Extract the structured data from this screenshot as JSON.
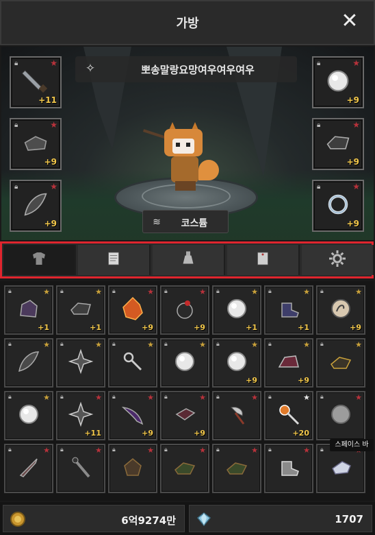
{
  "window": {
    "title": "가방",
    "close_icon": "close-icon"
  },
  "character": {
    "name": "뽀송말랑요망여우여우여우"
  },
  "costume_button": {
    "label": "코스튬",
    "icon": "layers-icon"
  },
  "equipped_left": [
    {
      "icon": "sword-icon",
      "enhance": "+11",
      "star": "red"
    },
    {
      "icon": "armor-icon",
      "enhance": "+9",
      "star": "red"
    },
    {
      "icon": "feather-icon",
      "enhance": "+9",
      "star": "red"
    }
  ],
  "equipped_right": [
    {
      "icon": "orb-icon",
      "enhance": "+9",
      "star": "red"
    },
    {
      "icon": "stone-icon",
      "enhance": "+9",
      "star": "red"
    },
    {
      "icon": "ring-icon",
      "enhance": "+9",
      "star": "red"
    }
  ],
  "tabs": [
    {
      "icon": "shirt-icon",
      "active": true
    },
    {
      "icon": "scroll-icon",
      "active": false
    },
    {
      "icon": "potion-icon",
      "active": false
    },
    {
      "icon": "note-icon",
      "active": false
    },
    {
      "icon": "gear-icon",
      "active": false
    }
  ],
  "inventory": [
    {
      "icon": "helmet-icon",
      "enhance": "+1",
      "star": "gold"
    },
    {
      "icon": "stone-icon",
      "enhance": "+1",
      "star": "gold"
    },
    {
      "icon": "fire-crystal-icon",
      "enhance": "+9",
      "star": "red"
    },
    {
      "icon": "bomb-icon",
      "enhance": "+9",
      "star": "red"
    },
    {
      "icon": "orb-icon",
      "enhance": "+1",
      "star": "gold"
    },
    {
      "icon": "boot-icon",
      "enhance": "+1",
      "star": "gold"
    },
    {
      "icon": "coin-orb-icon",
      "enhance": "+9",
      "star": "gold"
    },
    {
      "icon": "feather-icon",
      "enhance": "",
      "star": "gold"
    },
    {
      "icon": "shuriken-icon",
      "enhance": "",
      "star": "gold"
    },
    {
      "icon": "key-icon",
      "enhance": "",
      "star": "gold"
    },
    {
      "icon": "orb-icon",
      "enhance": "",
      "star": "gold"
    },
    {
      "icon": "orb-icon",
      "enhance": "+9",
      "star": "gold"
    },
    {
      "icon": "hat-icon",
      "enhance": "+9",
      "star": "gold"
    },
    {
      "icon": "bundle-icon",
      "enhance": "",
      "star": "gold"
    },
    {
      "icon": "orb-icon",
      "enhance": "",
      "star": "gold"
    },
    {
      "icon": "shuriken-icon",
      "enhance": "+11",
      "star": "red"
    },
    {
      "icon": "cape-icon",
      "enhance": "+9",
      "star": "red"
    },
    {
      "icon": "book-icon",
      "enhance": "+9",
      "star": "red"
    },
    {
      "icon": "axe-icon",
      "enhance": "",
      "star": "red"
    },
    {
      "icon": "wand-icon",
      "enhance": "+20",
      "star": "white"
    },
    {
      "icon": "orb-gray-icon",
      "enhance": "",
      "star": "red"
    },
    {
      "icon": "dagger-icon",
      "enhance": "",
      "star": "red"
    },
    {
      "icon": "staff-icon",
      "enhance": "",
      "star": "red"
    },
    {
      "icon": "vest-icon",
      "enhance": "",
      "star": "red"
    },
    {
      "icon": "cloth-icon",
      "enhance": "",
      "star": "red"
    },
    {
      "icon": "cloth-icon",
      "enhance": "",
      "star": "red"
    },
    {
      "icon": "boot-gray-icon",
      "enhance": "",
      "star": "red"
    },
    {
      "icon": "glove-icon",
      "enhance": "",
      "star": "red"
    }
  ],
  "tooltip": {
    "text": "스페이스 바"
  },
  "currency": {
    "gold": {
      "icon": "gold-coin-icon",
      "value": "6억9274만"
    },
    "gem": {
      "icon": "diamond-icon",
      "value": "1707"
    }
  },
  "colors": {
    "highlight": "#e0252e",
    "enhance": "#f3c84b",
    "star_red": "#b8323b",
    "star_gold": "#c9a13a"
  }
}
